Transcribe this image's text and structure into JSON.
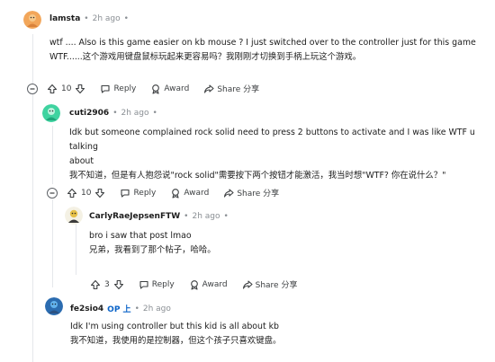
{
  "comments": [
    {
      "username": "lamsta",
      "time": "2h ago",
      "lines": [
        "wtf .... Also is this game easier on kb mouse ? I just switched over to the controller just for this game",
        "WTF......这个游戏用键盘鼠标玩起来更容易吗？我刚刚才切换到手柄上玩这个游戏。"
      ],
      "votes": "10",
      "reply_label": "Reply",
      "award_label": "Award",
      "share_label": "Share 分享"
    },
    {
      "username": "cuti2906",
      "time": "2h ago",
      "lines": [
        "Idk but someone complained rock solid need to press 2 buttons to activate and I was like WTF u talking",
        "about",
        "我不知道，但是有人抱怨说\"rock solid\"需要按下两个按钮才能激活，我当时想\"WTF? 你在说什么？\""
      ],
      "votes": "10",
      "reply_label": "Reply",
      "award_label": "Award",
      "share_label": "Share 分享"
    },
    {
      "username": "CarlyRaeJepsenFTW",
      "time": "2h ago",
      "lines": [
        "bro i saw that post lmao",
        "兄弟，我看到了那个帖子，哈哈。"
      ],
      "votes": "3",
      "reply_label": "Reply",
      "award_label": "Award",
      "share_label": "Share 分享"
    },
    {
      "username": "fe2sio4",
      "op_badge": "OP 上",
      "time": "2h ago",
      "lines": [
        "Idk I'm using controller but this kid is all about kb",
        "我不知道，我使用的是控制器，但这个孩子只喜欢键盘。"
      ]
    }
  ],
  "colors": {
    "accent": "#0a63c8",
    "thread_line": "#e5e7eb",
    "muted_text": "#8a8f94"
  }
}
